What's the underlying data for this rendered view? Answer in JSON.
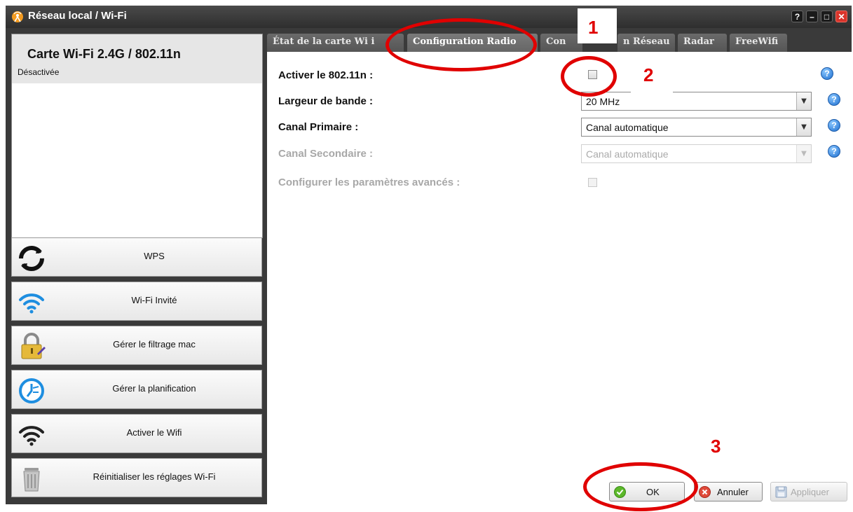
{
  "window": {
    "title": "Réseau local / Wi-Fi",
    "controls": [
      "?",
      "–",
      "□",
      "✕"
    ]
  },
  "card": {
    "title": "Carte Wi-Fi 2.4G / 802.11n",
    "status": "Désactivée"
  },
  "sidebar": {
    "items": [
      {
        "label": "WPS",
        "icon": "wps-icon"
      },
      {
        "label": "Wi-Fi Invité",
        "icon": "wifi-icon"
      },
      {
        "label": "Gérer le filtrage mac",
        "icon": "lock-icon"
      },
      {
        "label": "Gérer la planification",
        "icon": "schedule-icon"
      },
      {
        "label": "Activer le Wifi",
        "icon": "wifi-icon"
      },
      {
        "label": "Réinitialiser les réglages Wi-Fi",
        "icon": "trash-icon"
      }
    ]
  },
  "tabs": [
    {
      "label": "État de la carte Wi  i",
      "active": false
    },
    {
      "label": "Configuration Radio",
      "active": true
    },
    {
      "label": "Con",
      "active": false
    },
    {
      "label": "n Réseau",
      "active": false
    },
    {
      "label": "Radar",
      "active": false
    },
    {
      "label": "FreeWifi",
      "active": false
    }
  ],
  "form": {
    "activer_label": "Activer le 802.11n :",
    "activer_checked": false,
    "largeur_label": "Largeur de bande :",
    "largeur_value": "20 MHz",
    "canal_primaire_label": "Canal Primaire :",
    "canal_primaire_value": "Canal automatique",
    "canal_secondaire_label": "Canal Secondaire :",
    "canal_secondaire_value": "Canal automatique",
    "avances_label": "Configurer les paramètres avancés :",
    "help_glyph": "?"
  },
  "footer": {
    "ok_label": "OK",
    "annuler_label": "Annuler",
    "appliquer_label": "Appliquer"
  },
  "annotations": {
    "step1": "1",
    "step2": "2",
    "step3": "3",
    "color": "#e00000"
  }
}
